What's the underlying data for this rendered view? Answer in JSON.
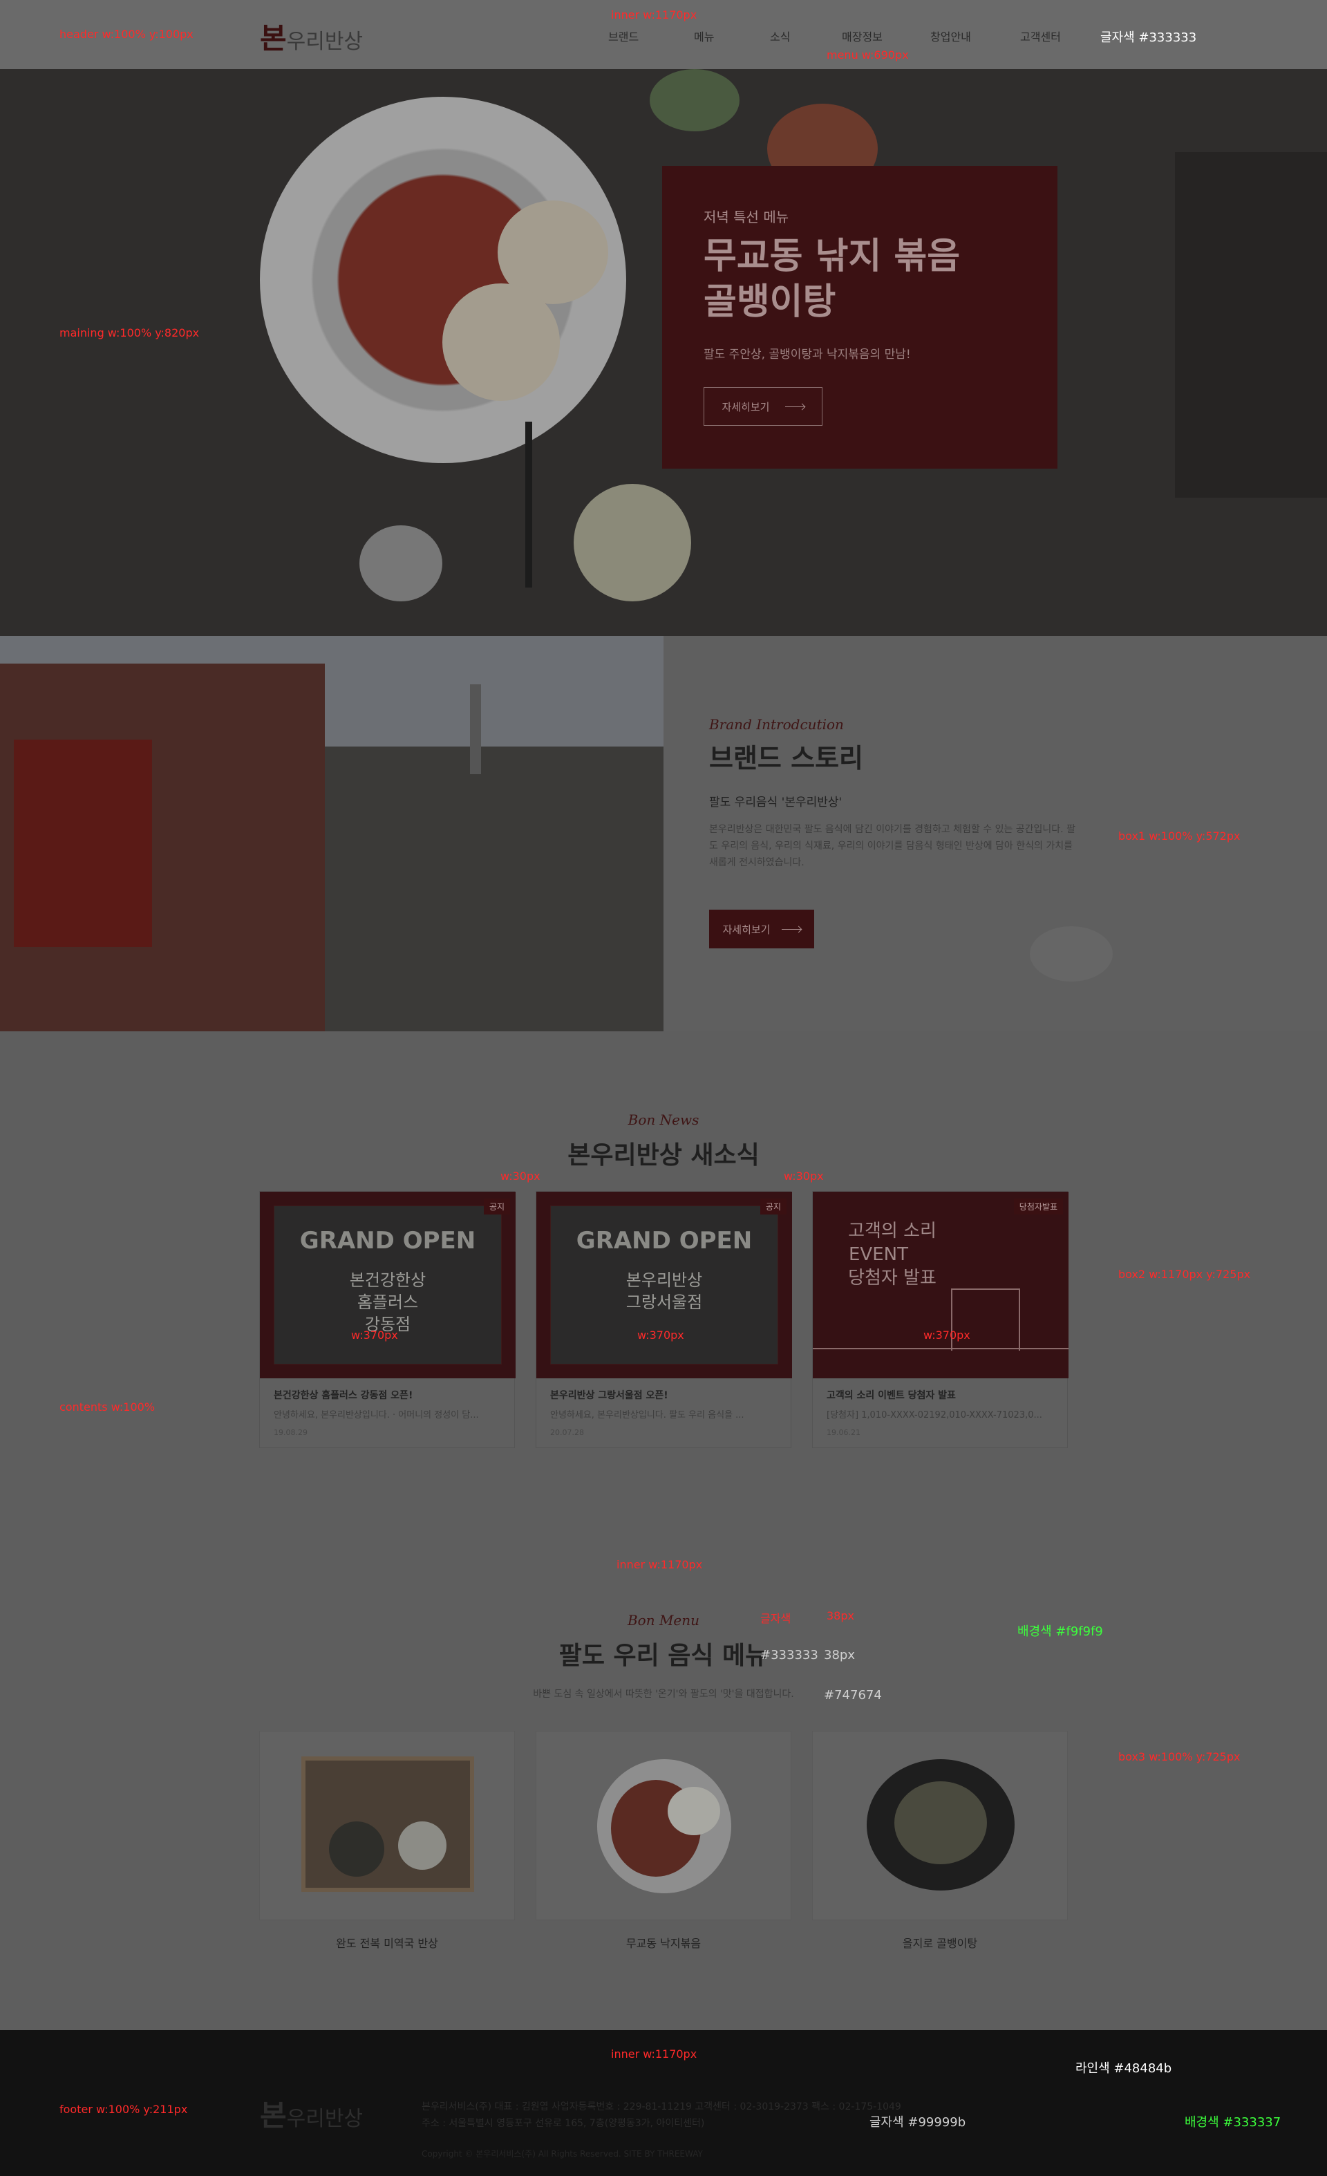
{
  "header": {
    "logo_main": "본",
    "logo_rest": "우리반상",
    "nav": [
      "브랜드",
      "메뉴",
      "소식",
      "매장정보",
      "창업안내",
      "고객센터"
    ]
  },
  "hero": {
    "subtitle": "저녁 특선 메뉴",
    "title_line1": "무교동 낚지 볶음",
    "title_line2": "골뱅이탕",
    "desc": "팔도 주안상, 골뱅이탕과 낙지볶음의 만남!",
    "button": "자세히보기"
  },
  "brand": {
    "eng": "Brand Introdcution",
    "title": "브랜드 스토리",
    "subtitle": "팔도 우리음식 '본우리반상'",
    "text": "본우리반상은 대한민국 팔도 음식에 담긴 이야기를 경험하고 체험할 수 있는 공간입니다. 팔도 우리의 음식, 우리의 식재료, 우리의 이야기를 담음식 형태인 반상에 담아 한식의 가치를 새롭게 전시하였습니다.",
    "button": "자세히보기"
  },
  "news": {
    "eng": "Bon News",
    "title": "본우리반상 새소식",
    "cards": [
      {
        "badge": "공지",
        "thumb_big": "GRAND OPEN",
        "thumb_lines": [
          "본건강한상",
          "홈플러스",
          "강동점"
        ],
        "title": "본건강한상 홈플러스 강동점 오픈!",
        "desc": "안녕하세요, 본우리반상입니다. · 어머니의 정성이 담...",
        "date": "19.08.29"
      },
      {
        "badge": "공지",
        "thumb_big": "GRAND OPEN",
        "thumb_lines": [
          "본우리반상",
          "그랑서울점"
        ],
        "title": "본우리반상 그랑서울점 오픈!",
        "desc": "안녕하세요, 본우리반상입니다.   팔도 우리 음식을 ...",
        "date": "20.07.28"
      },
      {
        "badge": "당첨자발표",
        "thumb_big": "",
        "thumb_lines": [
          "고객의 소리",
          "EVENT",
          "당첨자 발표"
        ],
        "title": "고객의 소리 이벤트 당첨자 발표",
        "desc": "[당첨자] 1,010-XXXX-02192,010-XXXX-71023,0...",
        "date": "19.06.21"
      }
    ]
  },
  "menu": {
    "eng": "Bon Menu",
    "title": "팔도 우리 음식 메뉴",
    "desc": "바쁜 도심 속 일상에서 따뜻한 '온기'와 팔도의 '맛'을 대접합니다.",
    "items": [
      "완도 전복 미역국 반상",
      "무교동 낙지볶음",
      "을지로 골뱅이탕"
    ]
  },
  "footer": {
    "logo_main": "본",
    "logo_rest": "우리반상",
    "line1": "본우리서비스(주)   대표 : 김원엽   사업자등록번호 : 229-81-11219   고객센터 : 02-3019-2373   팩스 : 02-175-1049",
    "line2": "주소 : 서울특별시 영등포구 선유로 165, 7층(양평동3가, 아이티센터)",
    "copyright": "Copyright © 본우리서비스(주) All Rights Reserved. SITE BY THREEWAY"
  },
  "annotations": {
    "header": "header w:100%  y:100px",
    "inner_top": "inner w:1170px",
    "menu_w": "menu w:690px",
    "text_color": "글자색 #333333",
    "main": "maining w:100%  y:820px",
    "box1": "box1 w:100%  y:572px",
    "gap1": "w:30px",
    "gap2": "w:30px",
    "box2": "box2 w:1170px  y:725px",
    "card_w1": "w:370px",
    "card_w2": "w:370px",
    "card_w3": "w:370px",
    "contents": "contents w:100%",
    "inner_mid": "inner w:1170px",
    "title_color_a": "글자색",
    "title_color_b": "38px",
    "bg_color": "배경색 #f9f9f9",
    "title_hex": "#333333",
    "title_size": "38px",
    "desc_hex": "#747674",
    "box3": "box3 w:100%  y:725px",
    "inner_foot": "inner w:1170px",
    "line_color": "라인색 #48484b",
    "footer": "footer w:100% y:211px",
    "foot_text_color": "글자색 #99999b",
    "foot_bg": "배경색 #333337"
  },
  "colors": {
    "brand_dark": "#3a1012",
    "text": "#333333",
    "footer_bg": "#121212"
  }
}
